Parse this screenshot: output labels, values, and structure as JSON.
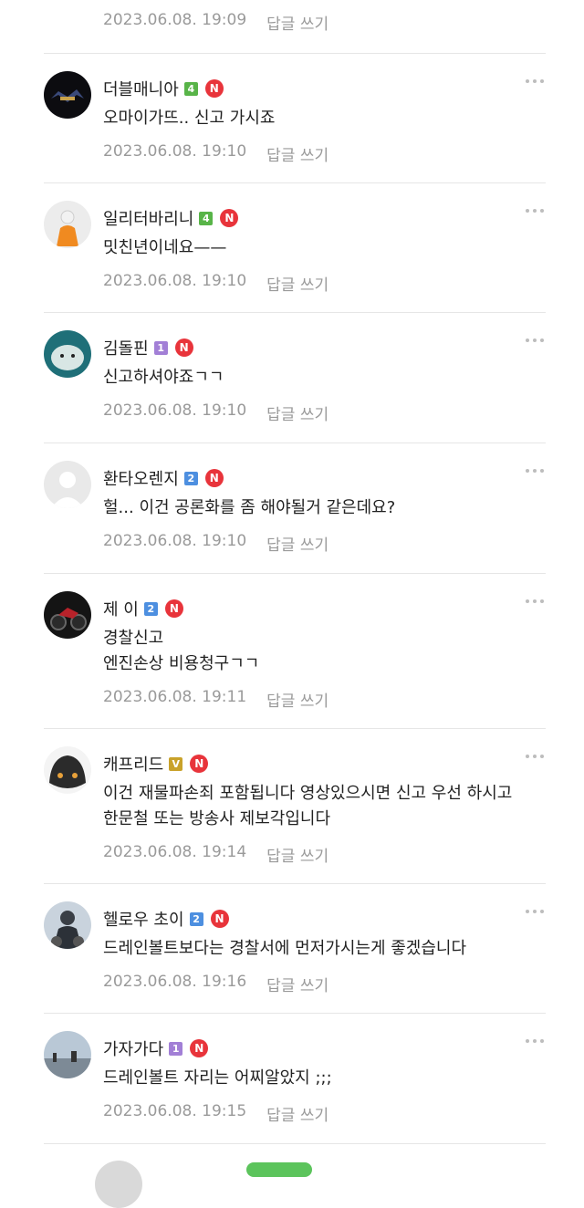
{
  "top_meta": {
    "timestamp": "2023.06.08. 19:09",
    "reply_label": "답글 쓰기"
  },
  "colors": {
    "level4": "#58b448",
    "level1": "#a27fd6",
    "level2": "#4d8fe0",
    "levelV": "#c9a22a",
    "new": "#e8343b"
  },
  "comments": [
    {
      "nickname": "더블매니아",
      "level": "4",
      "new_badge": "N",
      "lines": [
        "오마이가뜨.. 신고 가시죠"
      ],
      "timestamp": "2023.06.08. 19:10",
      "reply_label": "답글 쓰기"
    },
    {
      "nickname": "일리터바리니",
      "level": "4",
      "new_badge": "N",
      "lines": [
        "밋친년이네요——"
      ],
      "timestamp": "2023.06.08. 19:10",
      "reply_label": "답글 쓰기"
    },
    {
      "nickname": "김돌핀",
      "level": "1",
      "new_badge": "N",
      "lines": [
        "신고하셔야죠ㄱㄱ"
      ],
      "timestamp": "2023.06.08. 19:10",
      "reply_label": "답글 쓰기"
    },
    {
      "nickname": "환타오렌지",
      "level": "2",
      "new_badge": "N",
      "lines": [
        "헐... 이건 공론화를 좀 해야될거 같은데요?"
      ],
      "timestamp": "2023.06.08. 19:10",
      "reply_label": "답글 쓰기"
    },
    {
      "nickname": "제 이",
      "level": "2",
      "new_badge": "N",
      "lines": [
        "경찰신고",
        "엔진손상 비용청구ㄱㄱ"
      ],
      "timestamp": "2023.06.08. 19:11",
      "reply_label": "답글 쓰기"
    },
    {
      "nickname": "캐프리드",
      "level": "V",
      "new_badge": "N",
      "lines": [
        "이건 재물파손죄 포함됩니다 영상있으시면 신고 우선 하시고",
        "한문철 또는 방송사 제보각입니다"
      ],
      "timestamp": "2023.06.08. 19:14",
      "reply_label": "답글 쓰기"
    },
    {
      "nickname": "헬로우 초이",
      "level": "2",
      "new_badge": "N",
      "lines": [
        "드레인볼트보다는 경찰서에 먼저가시는게 좋겠습니다"
      ],
      "timestamp": "2023.06.08. 19:16",
      "reply_label": "답글 쓰기"
    },
    {
      "nickname": "가자가다",
      "level": "1",
      "new_badge": "N",
      "lines": [
        "드레인볼트 자리는 어찌알았지 ;;;"
      ],
      "timestamp": "2023.06.08. 19:15",
      "reply_label": "답글 쓰기"
    }
  ]
}
